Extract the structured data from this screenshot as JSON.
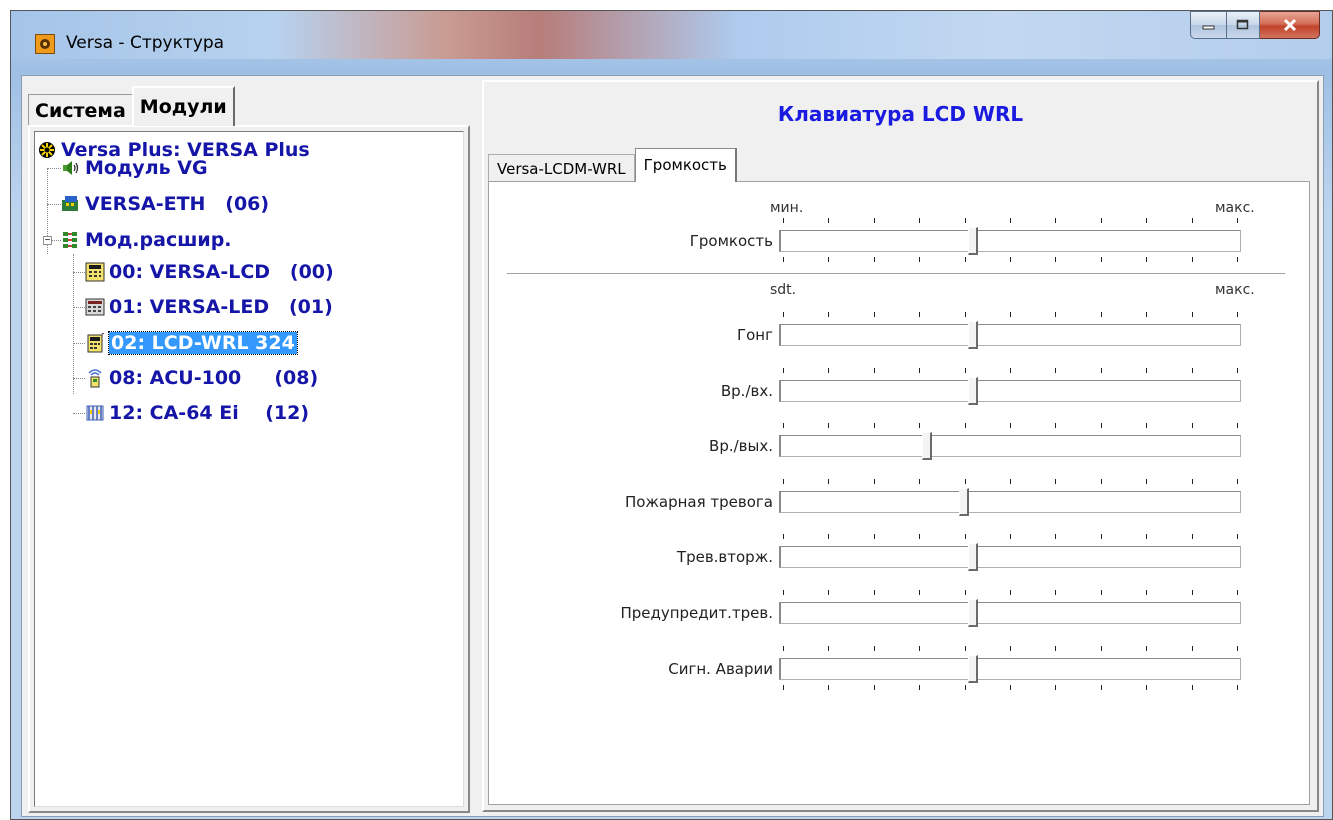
{
  "window": {
    "title": "Versa - Структура"
  },
  "left_tabs": [
    {
      "label": "Система",
      "active": false
    },
    {
      "label": "Модули",
      "active": true
    }
  ],
  "tree": {
    "root": "Versa Plus: VERSA Plus",
    "items": [
      {
        "label": "Модуль VG",
        "icon": "speaker-icon"
      },
      {
        "label": "VERSA-ETH   (06)",
        "icon": "network-module-icon"
      },
      {
        "label": "Мод.расшир.",
        "icon": "expanders-icon"
      },
      {
        "label": "00: VERSA-LCD   (00)",
        "icon": "lcd-keypad-icon"
      },
      {
        "label": "01: VERSA-LED   (01)",
        "icon": "led-keypad-icon"
      },
      {
        "label": "02: LCD-WRL 324",
        "icon": "wireless-keypad-icon",
        "selected": true
      },
      {
        "label": "08: ACU-100     (08)",
        "icon": "wireless-controller-icon"
      },
      {
        "label": "12: CA-64 Ei    (12)",
        "icon": "expander-module-icon"
      }
    ]
  },
  "right_header": "Клавиатура LCD WRL",
  "right_tabs": [
    {
      "label": "Versa-LCDM-WRL",
      "active": false
    },
    {
      "label": "Громкость",
      "active": true
    }
  ],
  "volume": {
    "scale_min": "мин.",
    "scale_max": "макс.",
    "label": "Громкость",
    "level": 0.41
  },
  "sounds": {
    "scale_min": "sdt.",
    "scale_max": "макс.",
    "rows": [
      {
        "label": "Гонг",
        "level": 0.41
      },
      {
        "label": "Вр./вх.",
        "level": 0.41
      },
      {
        "label": "Вр./вых.",
        "level": 0.31
      },
      {
        "label": "Пожарная тревога",
        "level": 0.39
      },
      {
        "label": "Трев.вторж.",
        "level": 0.41
      },
      {
        "label": "Предупредит.трев.",
        "level": 0.41
      },
      {
        "label": "Сигн. Аварии",
        "level": 0.41
      }
    ]
  }
}
